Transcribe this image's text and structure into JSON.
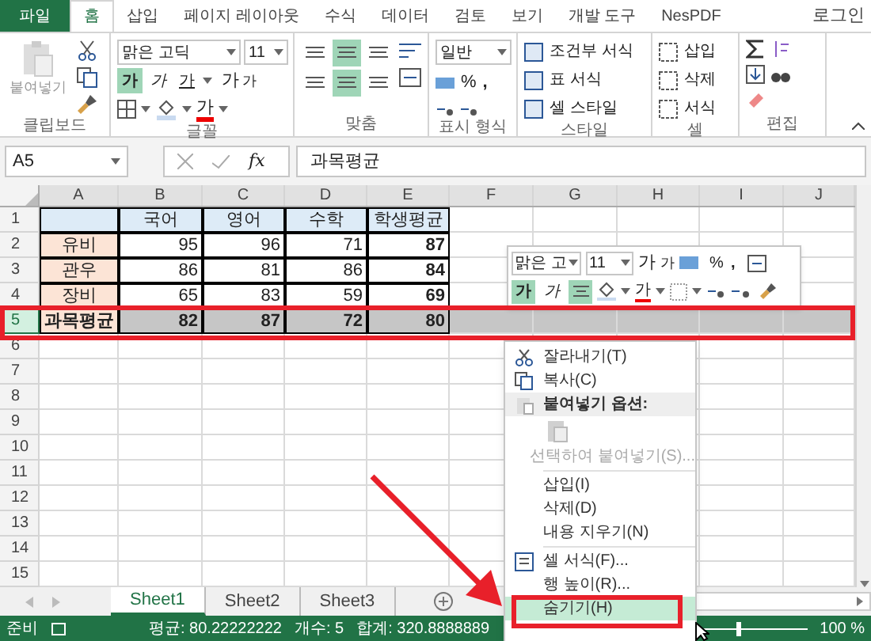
{
  "ribbon_tabs": [
    {
      "label": "파일",
      "kind": "file",
      "selected": false
    },
    {
      "label": "홈",
      "kind": "tab",
      "selected": true
    },
    {
      "label": "삽입",
      "kind": "tab",
      "selected": false
    },
    {
      "label": "페이지 레이아웃",
      "kind": "tab",
      "selected": false
    },
    {
      "label": "수식",
      "kind": "tab",
      "selected": false
    },
    {
      "label": "데이터",
      "kind": "tab",
      "selected": false
    },
    {
      "label": "검토",
      "kind": "tab",
      "selected": false
    },
    {
      "label": "보기",
      "kind": "tab",
      "selected": false
    },
    {
      "label": "개발 도구",
      "kind": "tab",
      "selected": false
    },
    {
      "label": "NesPDF",
      "kind": "tab",
      "selected": false
    }
  ],
  "account": "로그인",
  "ribbon": {
    "clipboard": {
      "title": "클립보드",
      "paste": "붙여넣기"
    },
    "font": {
      "title": "글꼴",
      "font_name": "맑은 고딕",
      "font_size": "11",
      "styles": [
        {
          "text": "가",
          "kind": "bold",
          "selected": true
        },
        {
          "text": "가",
          "kind": "italic",
          "selected": false
        },
        {
          "text": "가",
          "kind": "underline",
          "selected": false
        }
      ],
      "grow": "가",
      "shrink": "가",
      "font_color": "가"
    },
    "alignment": {
      "title": "맞춤",
      "buttons": [
        {
          "selected": false
        },
        {
          "selected": true
        },
        {
          "selected": false
        },
        {
          "selected": false
        },
        {
          "selected": true
        },
        {
          "selected": false
        }
      ]
    },
    "number": {
      "title": "표시 형식",
      "format": "일반",
      "percent": "%",
      "comma": ","
    },
    "styles": {
      "title": "스타일",
      "items": [
        "조건부 서식",
        "표 서식",
        "셀 스타일"
      ]
    },
    "cells": {
      "title": "셀",
      "items": [
        "삽입",
        "삭제",
        "서식"
      ]
    },
    "editing": {
      "title": "편집"
    }
  },
  "formula_bar": {
    "name_box": "A5",
    "fx": "fx",
    "value": "과목평균"
  },
  "columns": [
    "A",
    "B",
    "C",
    "D",
    "E",
    "F",
    "G",
    "H",
    "I",
    "J"
  ],
  "rows": [
    {
      "label": "1",
      "selected": false,
      "cells": [
        {
          "kind": "header"
        },
        {
          "text": "국어",
          "kind": "header"
        },
        {
          "text": "영어",
          "kind": "header"
        },
        {
          "text": "수학",
          "kind": "header"
        },
        {
          "text": "학생평균",
          "kind": "header"
        }
      ]
    },
    {
      "label": "2",
      "selected": false,
      "cells": [
        {
          "text": "유비",
          "kind": "name"
        },
        {
          "text": "95",
          "kind": "number"
        },
        {
          "text": "96",
          "kind": "number"
        },
        {
          "text": "71",
          "kind": "number"
        },
        {
          "text": "87",
          "kind": "total"
        }
      ]
    },
    {
      "label": "3",
      "selected": false,
      "cells": [
        {
          "text": "관우",
          "kind": "name"
        },
        {
          "text": "86",
          "kind": "number"
        },
        {
          "text": "81",
          "kind": "number"
        },
        {
          "text": "86",
          "kind": "number"
        },
        {
          "text": "84",
          "kind": "total"
        }
      ]
    },
    {
      "label": "4",
      "selected": false,
      "cells": [
        {
          "text": "장비",
          "kind": "name"
        },
        {
          "text": "65",
          "kind": "number"
        },
        {
          "text": "83",
          "kind": "number"
        },
        {
          "text": "59",
          "kind": "number"
        },
        {
          "text": "69",
          "kind": "total"
        }
      ]
    },
    {
      "label": "5",
      "selected": true,
      "cells": [
        {
          "text": "과목평균",
          "kind": "name"
        },
        {
          "text": "82",
          "kind": "total"
        },
        {
          "text": "87",
          "kind": "total"
        },
        {
          "text": "72",
          "kind": "total"
        },
        {
          "text": "80",
          "kind": "total"
        }
      ]
    },
    {
      "label": "6",
      "selected": false,
      "cells": []
    },
    {
      "label": "7",
      "selected": false,
      "cells": []
    },
    {
      "label": "8",
      "selected": false,
      "cells": []
    },
    {
      "label": "9",
      "selected": false,
      "cells": []
    },
    {
      "label": "10",
      "selected": false,
      "cells": []
    },
    {
      "label": "11",
      "selected": false,
      "cells": []
    },
    {
      "label": "12",
      "selected": false,
      "cells": []
    },
    {
      "label": "13",
      "selected": false,
      "cells": []
    },
    {
      "label": "14",
      "selected": false,
      "cells": []
    },
    {
      "label": "15",
      "selected": false,
      "cells": []
    }
  ],
  "mini_toolbar": {
    "font_name": "맑은 고",
    "font_size": "11",
    "grow": "가",
    "shrink": "가",
    "percent": "%",
    "comma": ",",
    "bold": {
      "text": "가",
      "selected": true
    },
    "italic": {
      "text": "가",
      "selected": false
    },
    "center_selected": true,
    "font_color": "가"
  },
  "context_menu": [
    {
      "label": "잘라내기(T)",
      "kind": "cut",
      "disabled": false,
      "selected": false
    },
    {
      "label": "복사(C)",
      "kind": "copy",
      "disabled": false,
      "selected": false
    },
    {
      "label": "붙여넣기 옵션:",
      "kind": "paste-header",
      "disabled": false,
      "selected": false
    },
    {
      "kind": "paste-option",
      "disabled": false,
      "selected": false
    },
    {
      "label": "선택하여 붙여넣기(S)...",
      "kind": "item",
      "disabled": true,
      "selected": false
    },
    {
      "kind": "separator"
    },
    {
      "label": "삽입(I)",
      "kind": "item",
      "disabled": false,
      "selected": false
    },
    {
      "label": "삭제(D)",
      "kind": "item",
      "disabled": false,
      "selected": false
    },
    {
      "label": "내용 지우기(N)",
      "kind": "item",
      "disabled": false,
      "selected": false
    },
    {
      "kind": "separator"
    },
    {
      "label": "셀 서식(F)...",
      "kind": "format",
      "disabled": false,
      "selected": false
    },
    {
      "label": "행 높이(R)...",
      "kind": "item",
      "disabled": false,
      "selected": false
    },
    {
      "label": "숨기기(H)",
      "kind": "item",
      "disabled": false,
      "selected": true
    }
  ],
  "sheet_tabs": [
    {
      "label": "Sheet1",
      "selected": true
    },
    {
      "label": "Sheet2",
      "selected": false
    },
    {
      "label": "Sheet3",
      "selected": false
    }
  ],
  "status_bar": {
    "ready": "준비",
    "average": "평균: 80.22222222",
    "count": "개수: 5",
    "sum": "합계: 320.8888889",
    "zoom": {
      "level": 0.5,
      "reading": "100 %"
    }
  }
}
